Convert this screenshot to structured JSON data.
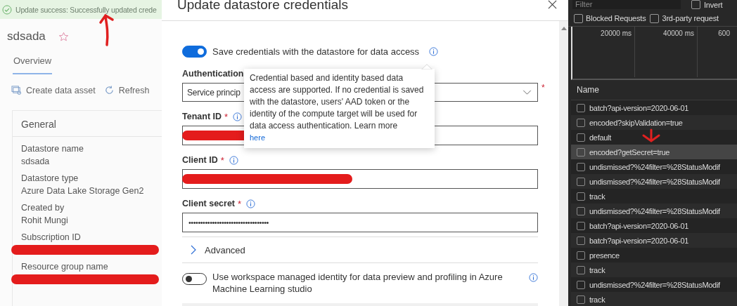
{
  "toast": {
    "text": "Update success: Successfully updated crede"
  },
  "datastore": {
    "title": "sdsada",
    "favorite": false,
    "tabs": [
      {
        "label": "Overview",
        "selected": true
      }
    ],
    "toolbar": [
      "Create data asset",
      "Refresh"
    ],
    "general": {
      "heading": "General",
      "fields": [
        {
          "label": "Datastore name",
          "value": "sdsada",
          "redacted": false
        },
        {
          "label": "Datastore type",
          "value": "Azure Data Lake Storage Gen2",
          "redacted": false
        },
        {
          "label": "Created by",
          "value": "Rohit Mungi",
          "redacted": false
        },
        {
          "label": "Subscription ID",
          "redacted": true
        },
        {
          "label": "Resource group name",
          "redacted": true
        }
      ]
    }
  },
  "dialog": {
    "title": "Update datastore credentials",
    "save_credentials": {
      "label": "Save credentials with the datastore for data access",
      "on": true
    },
    "tooltip": {
      "text": "Credential based and identity based data access are supported. If no credential is saved with the datastore, users' AAD token or the identity of the compute target will be used for data access authentication. Learn more",
      "link": "here"
    },
    "auth_label": "Authentication",
    "auth_value": "Service princip",
    "auth_required": true,
    "required_mark": "*",
    "fields": [
      {
        "label": "Tenant ID",
        "required": true,
        "redacted": true
      },
      {
        "label": "Client ID",
        "required": true,
        "redacted": true
      },
      {
        "label": "Client secret",
        "required": true,
        "redacted": false,
        "value": "••••••••••••••••••••••••••••••••••"
      }
    ],
    "advanced": {
      "label": "Advanced",
      "expanded": false
    },
    "managed_identity": {
      "label": "Use workspace managed identity for data preview and profiling in Azure Machine Learning studio",
      "on": false
    }
  },
  "devtools": {
    "filter_placeholder": "Filter",
    "invert": {
      "label": "Invert",
      "checked": false
    },
    "checks": [
      {
        "label": "Blocked Requests",
        "checked": false
      },
      {
        "label": "3rd-party request",
        "checked": false
      }
    ],
    "timeline_ticks": [
      "20000 ms",
      "40000 ms",
      "600"
    ],
    "name_header": "Name",
    "requests": [
      {
        "name": "batch?api-version=2020-06-01",
        "selected": false
      },
      {
        "name": "encoded?skipValidation=true",
        "selected": false
      },
      {
        "name": "default",
        "selected": false
      },
      {
        "name": "encoded?getSecret=true",
        "selected": true
      },
      {
        "name": "undismissed?%24filter=%28StatusModif",
        "selected": false
      },
      {
        "name": "undismissed?%24filter=%28StatusModif",
        "selected": false
      },
      {
        "name": "track",
        "selected": false
      },
      {
        "name": "undismissed?%24filter=%28StatusModif",
        "selected": false
      },
      {
        "name": "batch?api-version=2020-06-01",
        "selected": false
      },
      {
        "name": "batch?api-version=2020-06-01",
        "selected": false
      },
      {
        "name": "presence",
        "selected": false
      },
      {
        "name": "track",
        "selected": false
      },
      {
        "name": "undismissed?%24filter=%28StatusModif",
        "selected": false
      },
      {
        "name": "track",
        "selected": false
      }
    ]
  }
}
